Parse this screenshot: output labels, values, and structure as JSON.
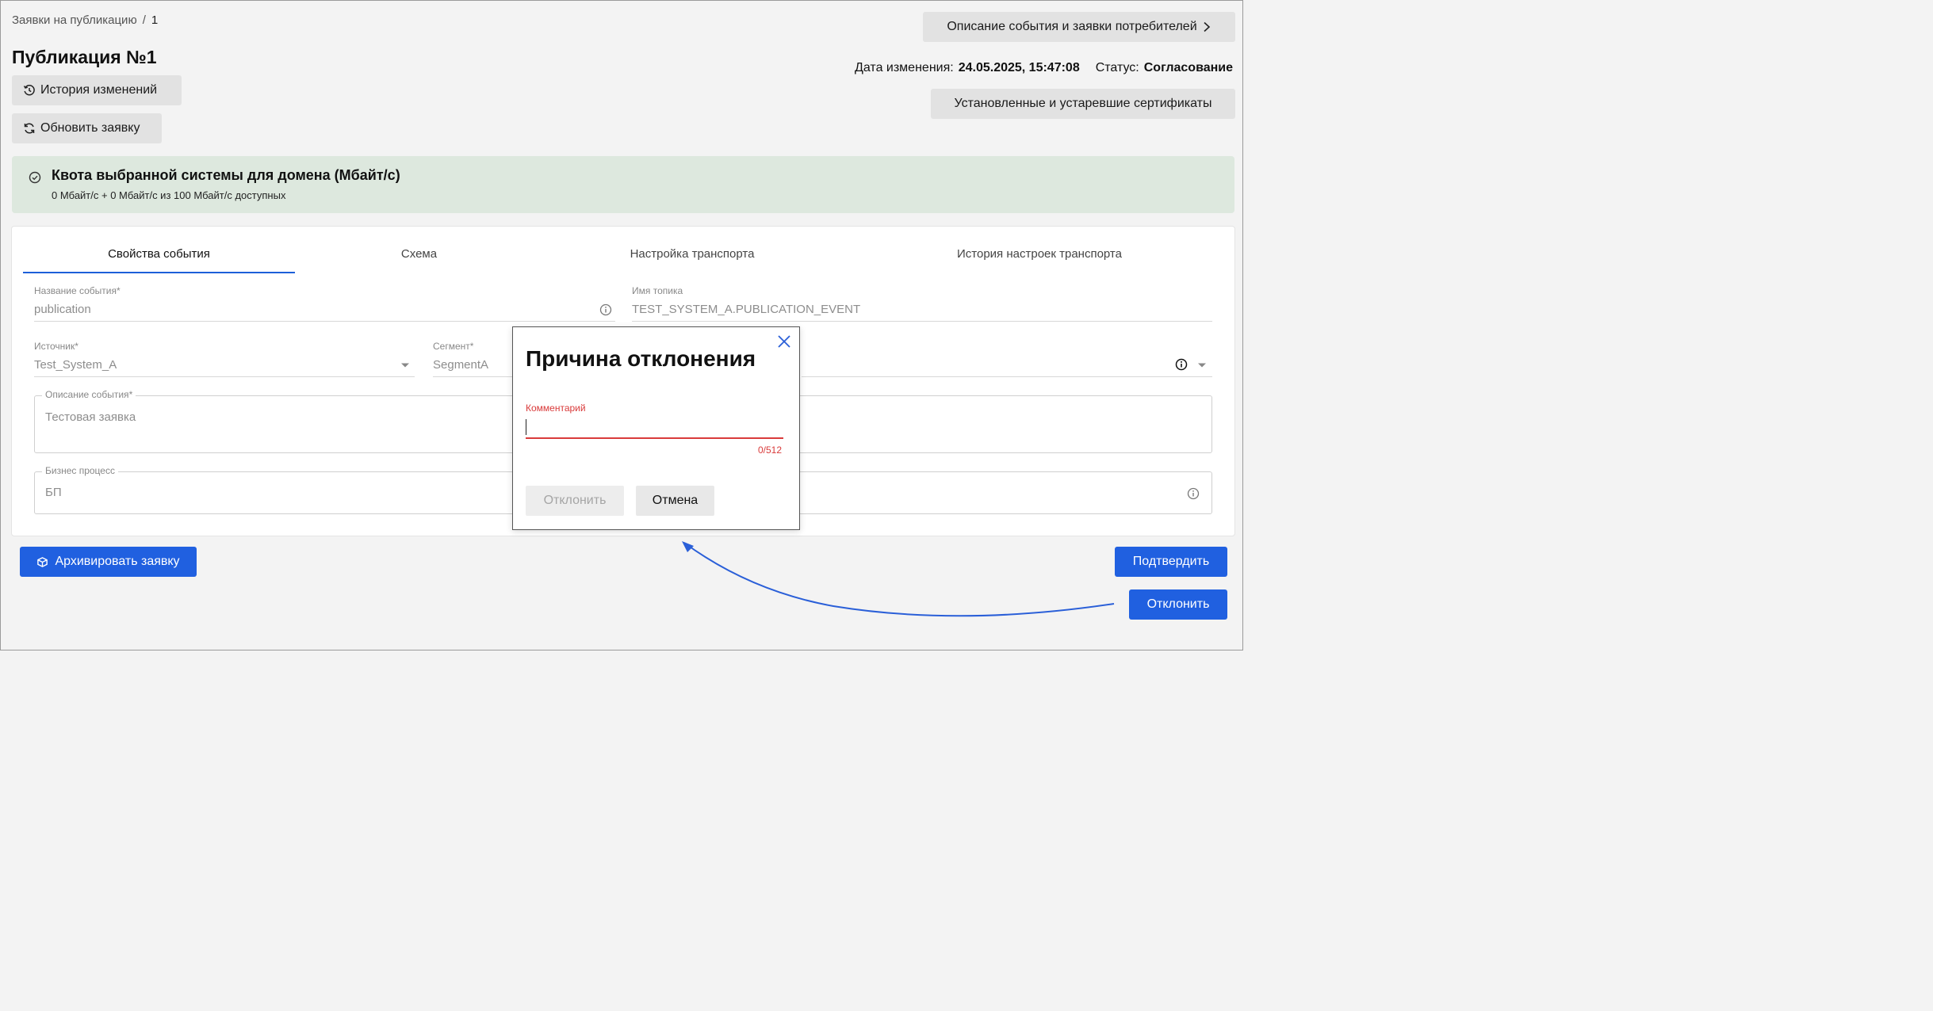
{
  "breadcrumb": {
    "parent": "Заявки на публикацию",
    "separator": "/",
    "current": "1"
  },
  "page_title": "Публикация №1",
  "buttons": {
    "history": "История изменений",
    "refresh": "Обновить заявку",
    "event_description": "Описание события и заявки потребителей",
    "certificates": "Установленные и устаревшие сертификаты",
    "archive": "Архивировать заявку",
    "confirm": "Подтвердить",
    "reject": "Отклонить"
  },
  "meta": {
    "date_label": "Дата изменения:",
    "date_value": "24.05.2025, 15:47:08",
    "status_label": "Статус:",
    "status_value": "Согласование"
  },
  "quota": {
    "title": "Квота выбранной системы для домена (Мбайт/с)",
    "subtitle": "0 Мбайт/с + 0 Мбайт/с из 100 Мбайт/с доступных"
  },
  "tabs": [
    {
      "label": "Свойства события",
      "active": true
    },
    {
      "label": "Схема",
      "active": false
    },
    {
      "label": "Настройка транспорта",
      "active": false
    },
    {
      "label": "История настроек транспорта",
      "active": false
    }
  ],
  "form": {
    "event_name": {
      "label": "Название события",
      "required": "*",
      "value": "publication"
    },
    "topic_name": {
      "label": "Имя топика",
      "value": "TEST_SYSTEM_A.PUBLICATION_EVENT"
    },
    "source": {
      "label": "Источник",
      "required": "*",
      "value": "Test_System_A"
    },
    "segment": {
      "label": "Сегмент",
      "required": "*",
      "value": "SegmentA"
    },
    "description": {
      "label": "Описание события",
      "required": "*",
      "value": "Тестовая заявка"
    },
    "business_process": {
      "label": "Бизнес процесс",
      "value": "БП"
    }
  },
  "modal": {
    "title": "Причина отклонения",
    "comment_label": "Комментарий",
    "comment_value": "",
    "counter": "0/512",
    "reject_label": "Отклонить",
    "cancel_label": "Отмена"
  },
  "colors": {
    "accent": "#2060e0",
    "error": "#d93a3a",
    "quota_bg": "#dde8de",
    "page_bg": "#f3f3f3"
  }
}
